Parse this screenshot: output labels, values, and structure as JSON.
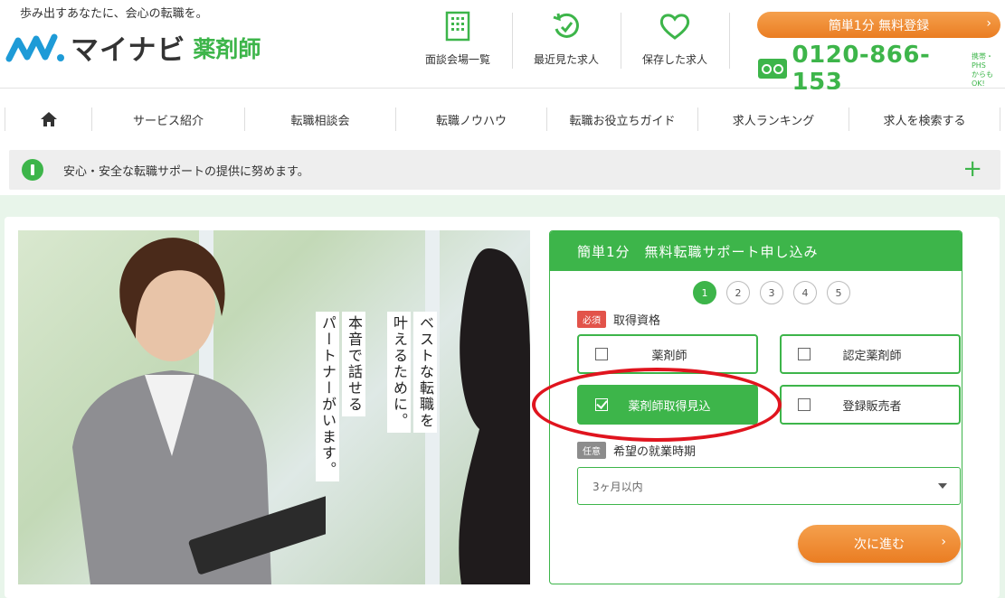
{
  "header": {
    "tagline": "歩み出すあなたに、会心の転職を。",
    "logo_text": "マイナビ",
    "logo_sub": "薬剤師",
    "nav": [
      {
        "label": "面談会場一覧",
        "icon": "building-icon"
      },
      {
        "label": "最近見た求人",
        "icon": "history-icon"
      },
      {
        "label": "保存した求人",
        "icon": "heart-icon"
      }
    ],
    "register_button": "簡単1分 無料登録",
    "phone_number": "0120-866-153",
    "phone_note_1": "携帯・PHS",
    "phone_note_2": "からもOK!"
  },
  "global_nav": [
    "サービス紹介",
    "転職相談会",
    "転職ノウハウ",
    "転職お役立ちガイド",
    "求人ランキング",
    "求人を検索する"
  ],
  "notice": {
    "text": "安心・安全な転職サポートの提供に努めます。"
  },
  "hero": {
    "copy_line_1": "ベストな転職を",
    "copy_line_2": "叶えるために。",
    "copy_line_3": "本音で話せる",
    "copy_line_4": "パートナーがいます。"
  },
  "form": {
    "title": "簡単1分　無料転職サポート申し込み",
    "steps": [
      "1",
      "2",
      "3",
      "4",
      "5"
    ],
    "current_step": 1,
    "q1_badge": "必須",
    "q1_label": "取得資格",
    "options": [
      {
        "label": "薬剤師",
        "selected": false
      },
      {
        "label": "認定薬剤師",
        "selected": false
      },
      {
        "label": "薬剤師取得見込",
        "selected": true
      },
      {
        "label": "登録販売者",
        "selected": false
      }
    ],
    "q2_badge": "任意",
    "q2_label": "希望の就業時期",
    "select_value": "3ヶ月以内",
    "next_button": "次に進む"
  },
  "colors": {
    "brand_green": "#3db54a",
    "accent_orange": "#ea7d22",
    "highlight_red": "#e0141e",
    "required_red": "#e2534a"
  }
}
